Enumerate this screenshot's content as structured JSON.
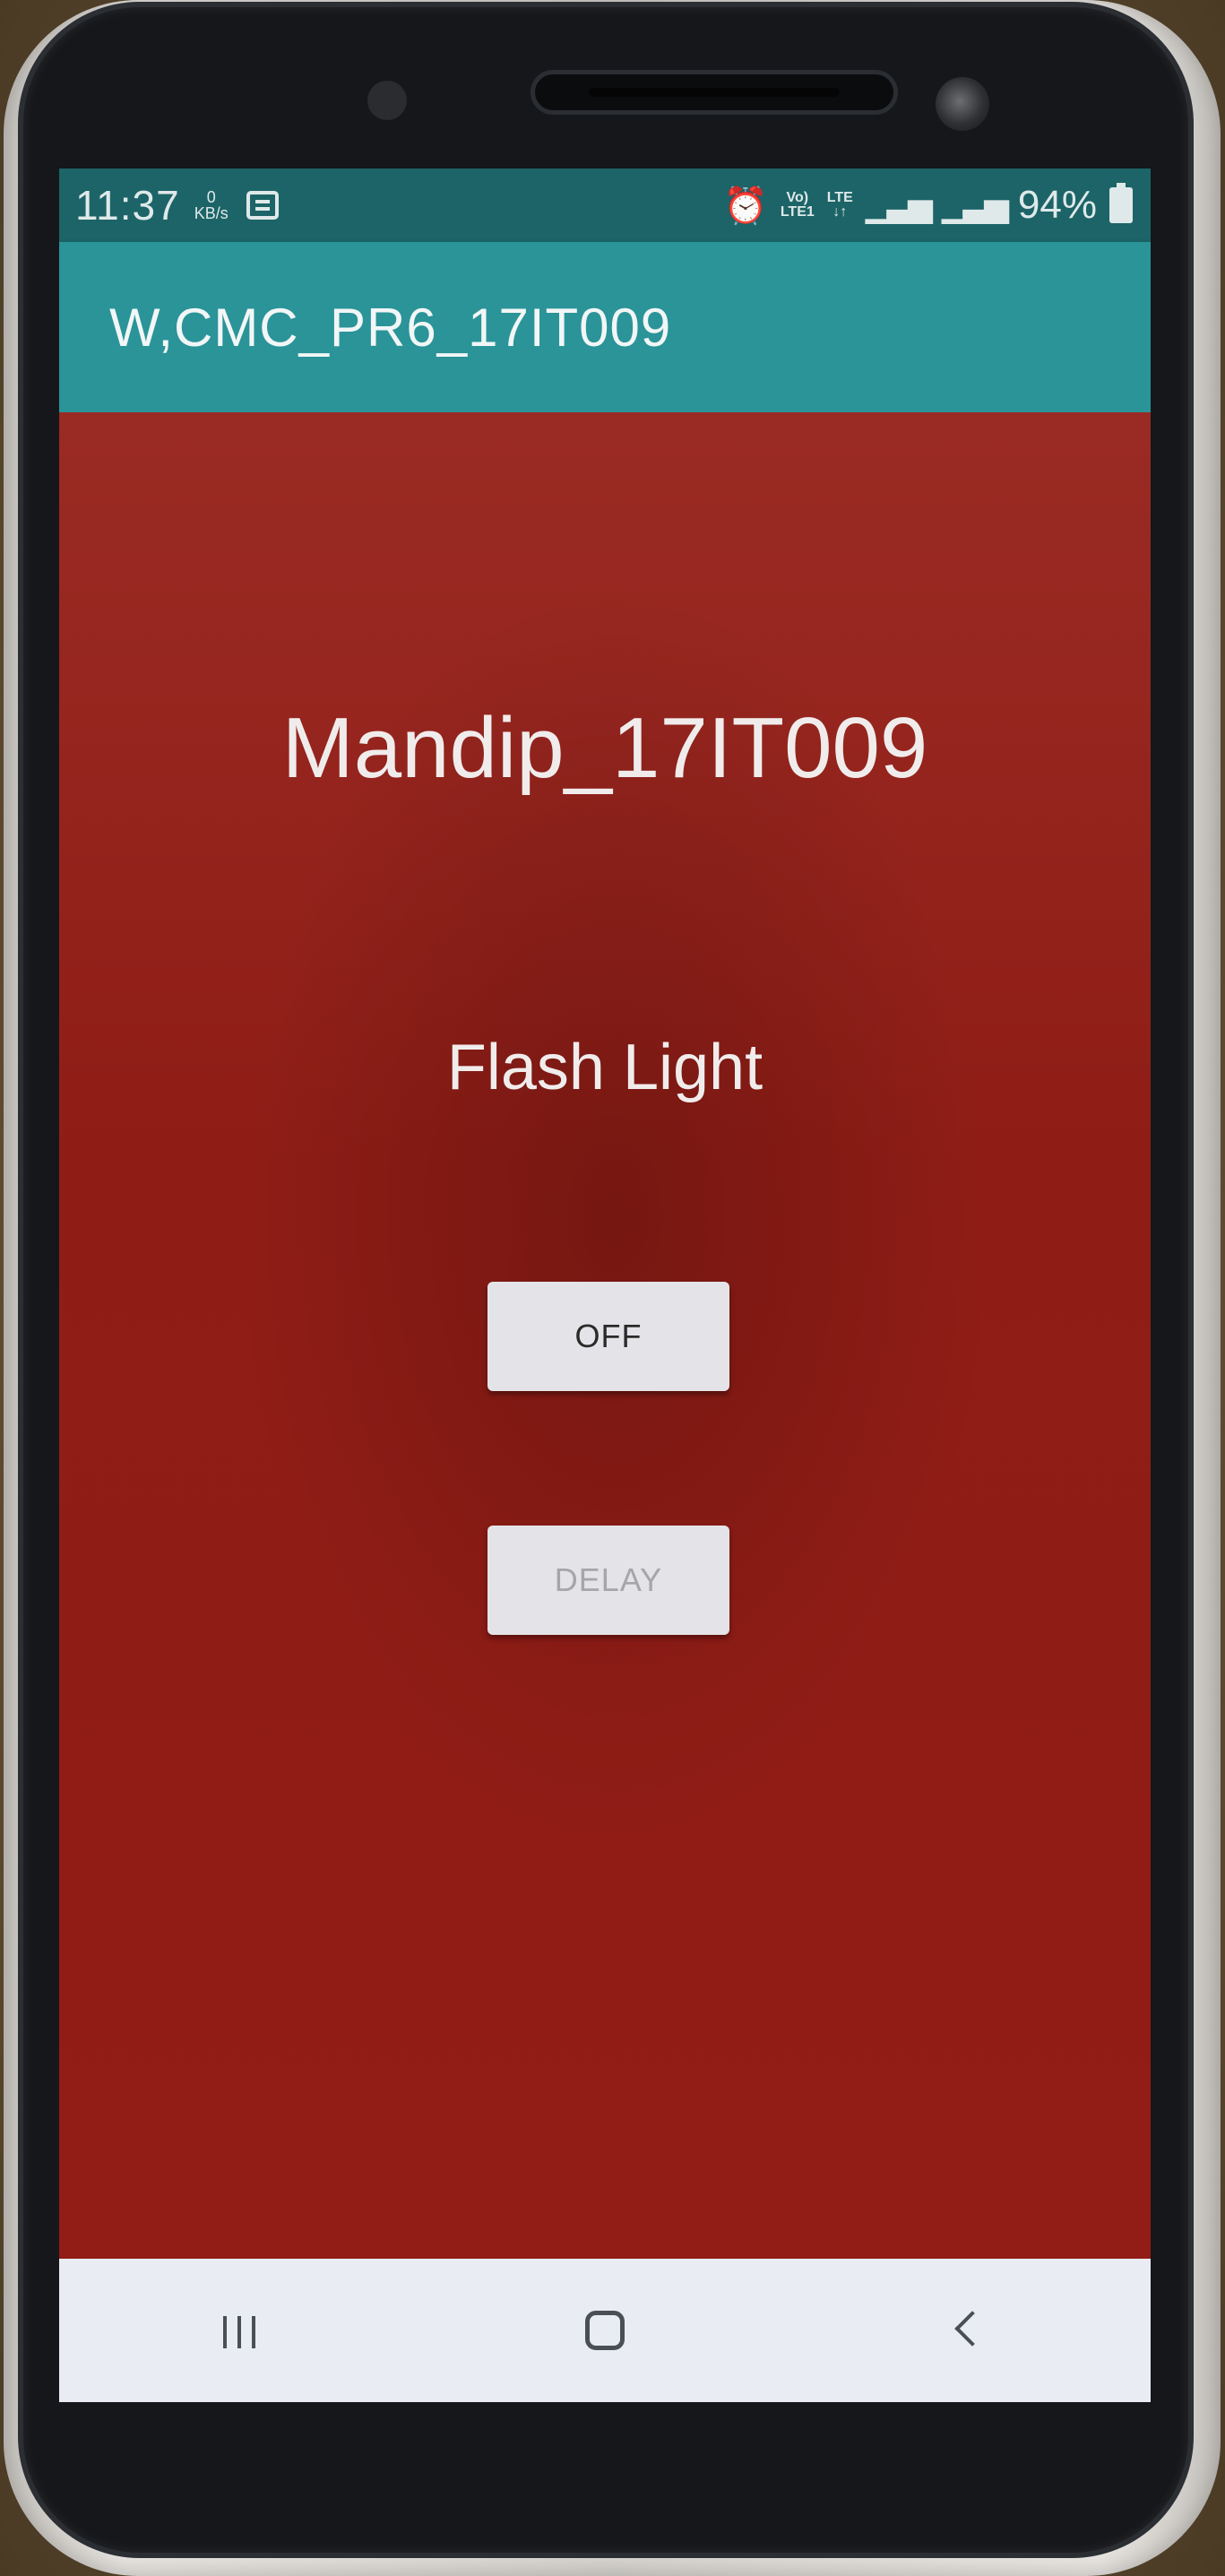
{
  "status_bar": {
    "time": "11:37",
    "net_speed_value": "0",
    "net_speed_unit": "KB/s",
    "volte_label": "Vo)",
    "lte1_label": "LTE1",
    "lte_label": "LTE",
    "battery": "94%"
  },
  "app_bar": {
    "title": "W,CMC_PR6_17IT009"
  },
  "content": {
    "name_heading": "Mandip_17IT009",
    "feature_heading": "Flash Light",
    "off_button": "OFF",
    "delay_button": "DELAY"
  },
  "colors": {
    "status_bar": "#1c6467",
    "app_bar": "#2a9499",
    "background": "#8e1e17",
    "button": "#e4e4e8"
  },
  "icons": {
    "nav": [
      "recent-apps-icon",
      "home-icon",
      "back-icon"
    ],
    "status": [
      "wifi-icon",
      "alarm-icon",
      "signal-icon",
      "battery-icon"
    ]
  }
}
